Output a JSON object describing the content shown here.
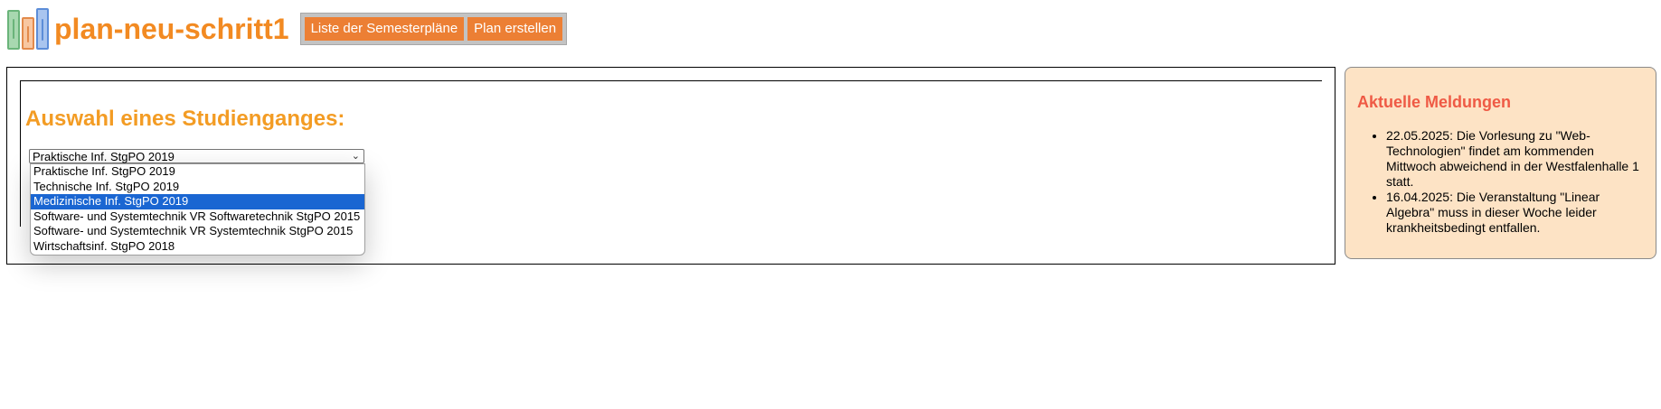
{
  "header": {
    "title": "plan-neu-schritt1",
    "nav_buttons": [
      {
        "label": "Liste der Semesterpläne"
      },
      {
        "label": "Plan erstellen"
      }
    ]
  },
  "main": {
    "heading": "Auswahl eines Studienganges:",
    "select": {
      "value": "Praktische Inf. StgPO 2019",
      "options": [
        "Praktische Inf. StgPO 2019",
        "Technische Inf. StgPO 2019",
        "Medizinische Inf. StgPO 2019",
        "Software- und Systemtechnik VR Softwaretechnik StgPO 2015",
        "Software- und Systemtechnik VR Systemtechnik StgPO 2015",
        "Wirtschaftsinf. StgPO 2018"
      ],
      "highlighted": "Medizinische Inf. StgPO 2019"
    }
  },
  "news": {
    "title": "Aktuelle Meldungen",
    "items": [
      "22.05.2025: Die Vorlesung zu \"Web-Technologien\" findet am kommenden Mittwoch abweichend in der Westfalenhalle 1 statt.",
      "16.04.2025: Die Veranstaltung \"Linear Algebra\" muss in dieser Woche leider krankheitsbedingt entfallen."
    ]
  },
  "colors": {
    "brand_orange": "#f28a22",
    "button_orange": "#ec7f34",
    "heading_orange": "#f39c24",
    "news_background": "#fde3c5",
    "news_title_red": "#ef5a45",
    "selection_blue": "#1a66d2"
  },
  "icons": {
    "logo": "books-icon",
    "select_chevron": "chevron-down-icon"
  }
}
